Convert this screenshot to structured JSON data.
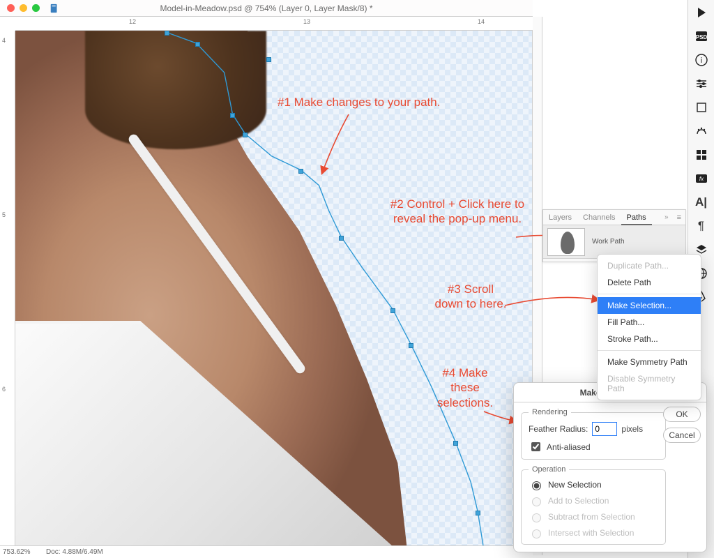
{
  "window": {
    "title": "Model-in-Meadow.psd @ 754% (Layer 0, Layer Mask/8) *"
  },
  "ruler": {
    "h": [
      "12",
      "13",
      "14"
    ],
    "v": [
      "4",
      "5",
      "6"
    ]
  },
  "annotations": {
    "a1": "#1 Make changes to your path.",
    "a2": "#2 Control + Click here to reveal the pop-up menu.",
    "a3": "#3 Scroll down to here.",
    "a4": "#4 Make these selections."
  },
  "panel": {
    "tabs": {
      "layers": "Layers",
      "channels": "Channels",
      "paths": "Paths"
    },
    "workpath": "Work Path"
  },
  "ctx": {
    "dup": "Duplicate Path...",
    "del": "Delete Path",
    "make": "Make Selection...",
    "fill": "Fill Path...",
    "stroke": "Stroke Path...",
    "sym": "Make Symmetry Path",
    "dsym": "Disable Symmetry Path"
  },
  "dialog": {
    "title": "Make Selection",
    "rendering": "Rendering",
    "feather_label": "Feather Radius:",
    "feather_value": "0",
    "feather_unit": "pixels",
    "aa": "Anti-aliased",
    "operation": "Operation",
    "op_new": "New Selection",
    "op_add": "Add to Selection",
    "op_sub": "Subtract from Selection",
    "op_int": "Intersect with Selection",
    "ok": "OK",
    "cancel": "Cancel"
  },
  "status": {
    "zoom": "753.62%",
    "doc": "Doc: 4.88M/6.49M"
  },
  "iconstrip": {
    "play": "play-icon",
    "psd": "psd-icon",
    "info": "info-icon",
    "sliders": "sliders-icon",
    "crop": "crop-icon",
    "swatch": "swatches-icon",
    "grid": "grid-icon",
    "fx": "fx-icon",
    "type": "type-icon",
    "para": "paragraph-icon",
    "layers": "layers-icon",
    "world": "world-icon",
    "pen": "pen-icon"
  }
}
